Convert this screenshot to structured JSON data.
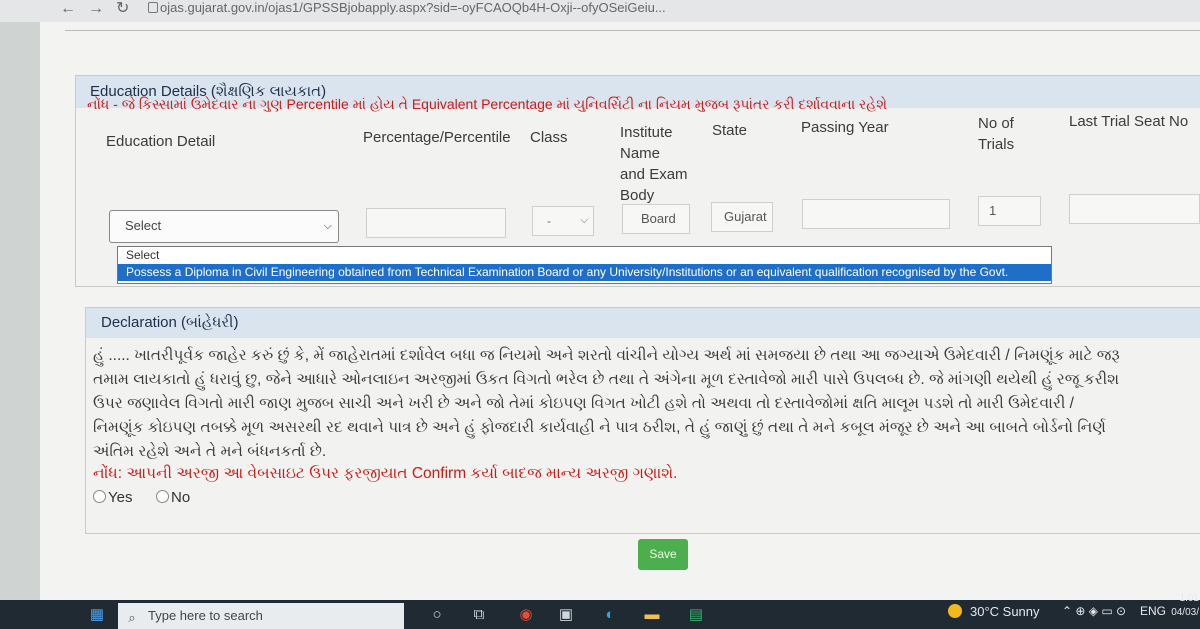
{
  "browser": {
    "url": "ojas.gujarat.gov.in/ojas1/GPSSBjobapply.aspx?sid=-oyFCAOQb4H-Oxji--ofyOSeiGeiu..."
  },
  "education": {
    "title": "Education Details (શૈક્ષણિક લાયકાત)",
    "note": "નોંધ - જે કિસ્સામાં ઉમેદવાર ના ગુણ Percentile માં હોય તે Equivalent Percentage માં યુનિવર્સિટી ના નિયમ મુજબ રૂપાંતર કરી દર્શાવવાના રહેશે",
    "columns": {
      "education_detail": "Education Detail",
      "percentage": "Percentage/Percentile",
      "class": "Class",
      "institute_1": "Institute",
      "institute_2": "Name",
      "institute_3": "and Exam",
      "institute_4": "Body",
      "state": "State",
      "passing_year": "Passing Year",
      "no_of_trials_1": "No of",
      "no_of_trials_2": "Trials",
      "last_trial_seat_no": "Last Trial Seat No"
    },
    "row": {
      "education_select": "Select",
      "class_select": "-",
      "institute": "Board",
      "state": "Gujarat",
      "trials": "1"
    },
    "dropdown_options": [
      "Select",
      "Possess a Diploma in Civil Engineering obtained from Technical Examination Board or any University/Institutions or an equivalent qualification recognised by the Govt."
    ]
  },
  "declaration": {
    "title": "Declaration (બાંહેધરી)",
    "lines": [
      "હું ..... ખાતરીપૂર્વક જાહેર કરું છું કે, મેં જાહેરાતમાં દર્શાવેલ બધા જ નિયમો અને શરતો વાંચીને યોગ્ય અર્થ માં સમજયા છે તથા આ જગ્યાએ ઉમેદવારી / નિમણૂંક માટે જરૂ",
      "તમામ લાયકાતો હું ધરાવું છુ, જેને આધારે ઓનલાઇન અરજીમાં ઉકત વિગતો ભરેલ છે તથા તે અંગેના મૂળ દસ્તાવેજો મારી પાસે ઉપલબ્ધ છે. જે માંગણી થયેથી હું રજૂ કરીશ",
      "ઉપર જણાવેલ વિગતો મારી જાણ મુજબ સાચી અને ખરી છે અને જો તેમાં કોઇપણ વિગત ખોટી હશે તો અથવા તો દસ્તાવેજોમાં ક્ષતિ માલૂમ પડશે તો મારી ઉમેદવારી /",
      "નિમણૂંક કોઇપણ તબક્કે મૂળ અસરથી રદ થવાને પાત્ર છે અને હું ફોજદારી કાર્યવાહી ને પાત્ર ઠરીશ, તે હું જાણું છું તથા તે મને કબૂલ મંજૂર છે અને આ બાબતે બોર્ડનો નિર્ણ",
      "અંતિમ રહેશે અને તે મને બંધનકર્તા છે."
    ],
    "note": "નોંધ: આપની અરજી આ વેબસાઇટ ઉપર ફરજીયાત Confirm કર્યા બાદજ માન્ય અરજી ગણાશે.",
    "yes_label": "Yes",
    "no_label": "No"
  },
  "save_label": "Save",
  "taskbar": {
    "search_placeholder": "Type here to search",
    "weather": "30°C  Sunny",
    "language": "ENG",
    "time": "1:01",
    "date": "04/03/"
  }
}
